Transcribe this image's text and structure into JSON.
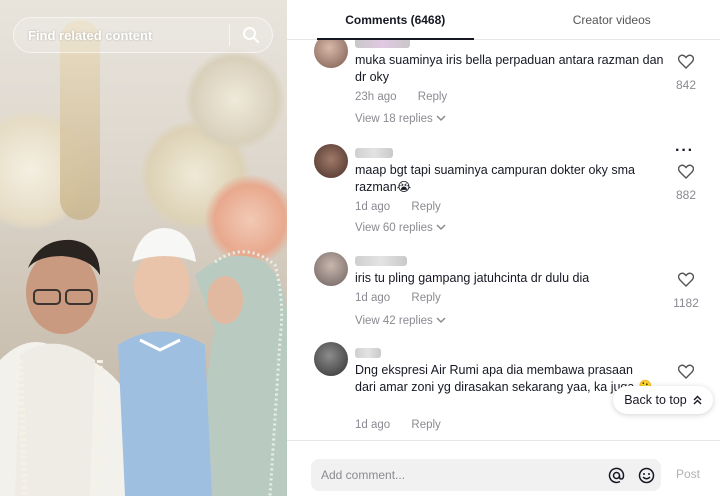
{
  "search": {
    "placeholder": "Find related content"
  },
  "tabs": [
    {
      "label": "Comments (6468)",
      "active": true
    },
    {
      "label": "Creator videos",
      "active": false
    }
  ],
  "comments": [
    {
      "text": "muka suaminya iris bella perpaduan antara razman dan dr oky",
      "time": "23h ago",
      "reply_label": "Reply",
      "replies": "View 18 replies",
      "likes": "842"
    },
    {
      "text": "maap bgt tapi suaminya campuran dokter oky sma razman😭",
      "time": "1d ago",
      "reply_label": "Reply",
      "replies": "View 60 replies",
      "likes": "882"
    },
    {
      "text": "iris tu pling gampang jatuhcinta dr dulu dia",
      "time": "1d ago",
      "reply_label": "Reply",
      "replies": "View 42 replies",
      "likes": "1182"
    },
    {
      "text": "Dng ekspresi Air Rumi apa dia membawa prasaan dari amar zoni yg dirasakan sekarang yaa, ka juga 🫠",
      "time": "1d ago",
      "reply_label": "Reply",
      "replies": "",
      "likes": ""
    }
  ],
  "back_to_top": "Back to top",
  "footer": {
    "input_placeholder": "Add comment...",
    "post_label": "Post"
  }
}
